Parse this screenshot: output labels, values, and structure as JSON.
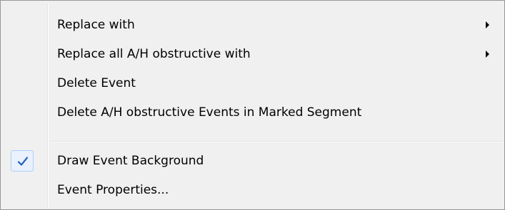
{
  "menu": {
    "items": [
      {
        "label": "Replace with",
        "submenu": true
      },
      {
        "label": "Replace all A/H obstructive with",
        "submenu": true
      },
      {
        "label": "Delete Event",
        "submenu": false
      },
      {
        "label": "Delete A/H obstructive Events in Marked Segment",
        "submenu": false
      },
      {
        "label": "Draw Event Background",
        "checked": true
      },
      {
        "label": "Event Properties...",
        "submenu": false
      }
    ]
  },
  "icons": {
    "submenu_arrow": "chevron-right-icon",
    "checkmark": "checkmark-icon"
  },
  "colors": {
    "menu_background": "#f0f0f0",
    "menu_border": "#979797",
    "checkmark": "#1f5bbf",
    "check_highlight": "#e8f1fc"
  }
}
